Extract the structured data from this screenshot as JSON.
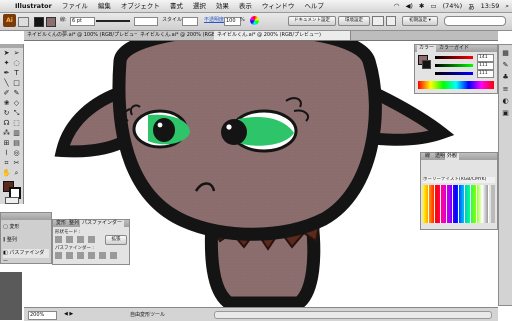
{
  "menubar": {
    "app_name": "Illustrator",
    "menus": [
      "ファイル",
      "編集",
      "オブジェクト",
      "書式",
      "選択",
      "効果",
      "表示",
      "ウィンドウ",
      "ヘルプ"
    ],
    "battery": "(74%)",
    "input_method": "あ",
    "clock": "13:59"
  },
  "control_bar": {
    "app_icon": "Ai",
    "stroke_label": "線:",
    "stroke_value": "6 pt",
    "style_label": "スタイル",
    "opacity_label": "不透明度",
    "opacity_value": "100",
    "doc_setup_button": "ドキュメント設定",
    "prefs_button": "環境設定",
    "workspace": "初期設定 ▾"
  },
  "tabs": [
    {
      "label": "ネイビルくんの夢.ai* @ 100% (RGB/プレビュー)"
    },
    {
      "label": "ネイビルくん.ai* @ 200% (RGB/プレビュー)"
    },
    {
      "label": "ネイビルくん.ai* @ 200% (RGB/プレビュー)"
    }
  ],
  "color_panel": {
    "tabs": [
      "カラー",
      "カラーガイド"
    ],
    "r_value": "141",
    "g_value": "111",
    "b_value": "111"
  },
  "swatch_panel": {
    "tabs": [
      "線",
      "透明",
      "外観"
    ],
    "title": "ボーリーテイスト(RGB/CMYK)"
  },
  "pathfinder_panel": {
    "tabs": [
      "変形",
      "整列",
      "パスファインダー"
    ],
    "shape_mode_label": "形状モード :",
    "expand_button": "拡張",
    "pathfinder_label": "パスファインダー :"
  },
  "collapsed_panels": {
    "items": [
      "変形",
      "整列",
      "パスファインダー"
    ]
  },
  "status_bar": {
    "zoom": "200%",
    "tool_name": "自由変形ツール"
  },
  "colors": {
    "skin": "#8c6e6e",
    "outline": "#141414",
    "eye_green": "#2ec56a",
    "collar": "#5a2a1e"
  }
}
